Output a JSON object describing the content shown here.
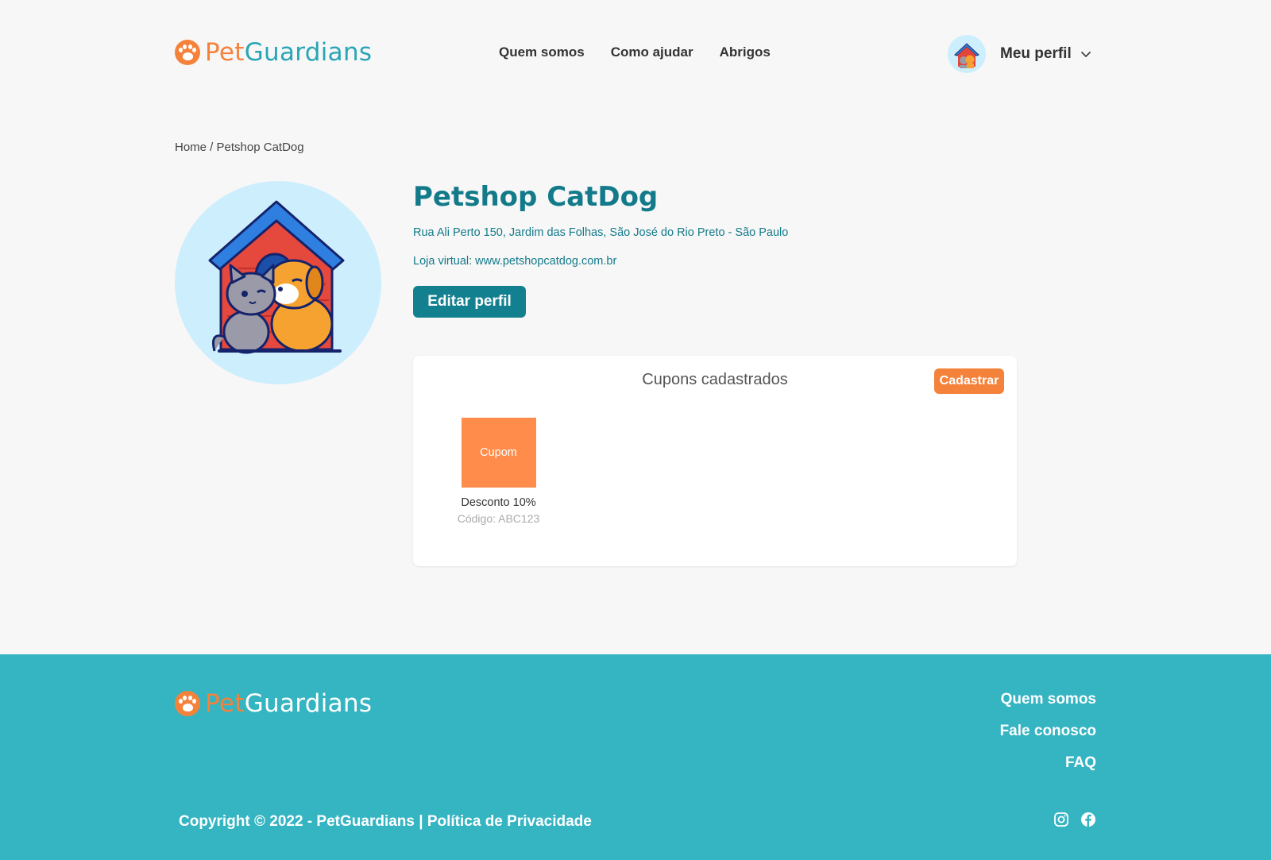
{
  "brand": {
    "part1": "Pet",
    "part2": "Guardians",
    "accent": "#f5823a",
    "teal": "#2aa5b5"
  },
  "nav": {
    "items": [
      "Quem somos",
      "Como ajudar",
      "Abrigos"
    ]
  },
  "profile": {
    "label": "Meu perfil",
    "icon": "chevron-down-icon"
  },
  "breadcrumb": {
    "home": "Home",
    "separator": " / ",
    "current": "Petshop CatDog"
  },
  "store": {
    "name": "Petshop CatDog",
    "address": "Rua Ali Perto 150, Jardim das Folhas, São José do Rio Preto - São Paulo",
    "site": "Loja virtual: www.petshopcatdog.com.br",
    "edit_label": "Editar perfil"
  },
  "coupons": {
    "title": "Cupons cadastrados",
    "add_label": "Cadastrar",
    "items": [
      {
        "thumb": "Cupom",
        "title": "Desconto 10%",
        "code": "Código: ABC123"
      }
    ]
  },
  "footer": {
    "links": [
      "Quem somos",
      "Fale conosco",
      "FAQ"
    ],
    "copyright": "Copyright © 2022 - PetGuardians | ",
    "privacy": "Política de Privacidade",
    "social": [
      "instagram-icon",
      "facebook-icon"
    ],
    "bg": "#35b4c2"
  }
}
